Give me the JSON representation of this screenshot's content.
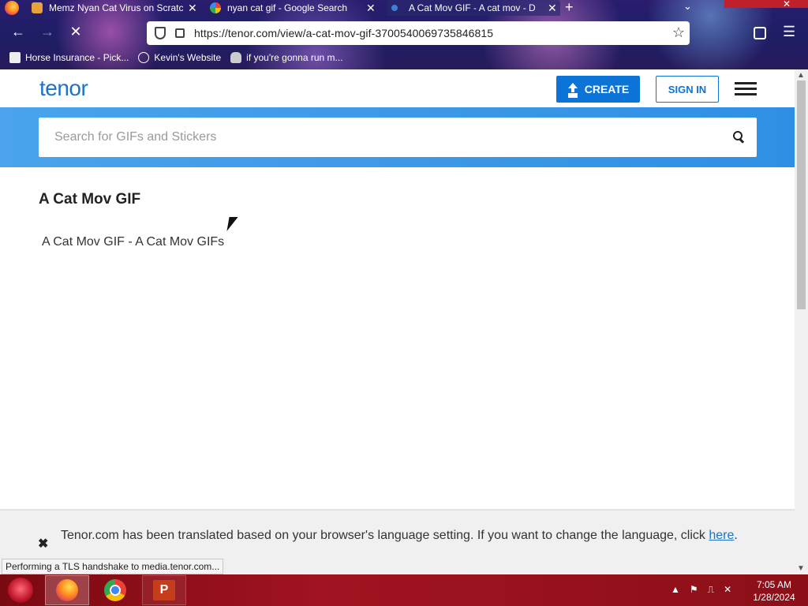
{
  "browser": {
    "tabs": [
      {
        "title": "Memz Nyan Cat Virus on Scratc",
        "icon": "scratch-icon"
      },
      {
        "title": "nyan cat gif - Google Search",
        "icon": "google-icon"
      },
      {
        "title": "A Cat Mov GIF - A cat mov - D",
        "icon": "tenor-icon"
      }
    ],
    "new_tab": "+",
    "url": "https://tenor.com/view/a-cat-mov-gif-3700540069735846815",
    "bookmarks": [
      {
        "label": "Horse Insurance - Pick..."
      },
      {
        "label": "Kevin's Website"
      },
      {
        "label": "if you're gonna run m..."
      }
    ],
    "status_text": "Performing a TLS handshake to media.tenor.com..."
  },
  "site": {
    "logo": "tenor",
    "create_label": "CREATE",
    "signin_label": "SIGN IN",
    "search_placeholder": "Search for GIFs and Stickers"
  },
  "content": {
    "title": "A Cat Mov GIF",
    "gif_caption": "A Cat Mov GIF - A Cat Mov GIFs"
  },
  "notice": {
    "text": "Tenor.com has been translated based on your browser's language setting. If you want to change the language, click ",
    "link": "here",
    "end": "."
  },
  "taskbar": {
    "time": "7:05 AM",
    "date": "1/28/2024",
    "ppt_letter": "P"
  },
  "colors": {
    "accent": "#0b74d6",
    "search_band": "#3a98e8",
    "taskbar": "#a11320"
  }
}
